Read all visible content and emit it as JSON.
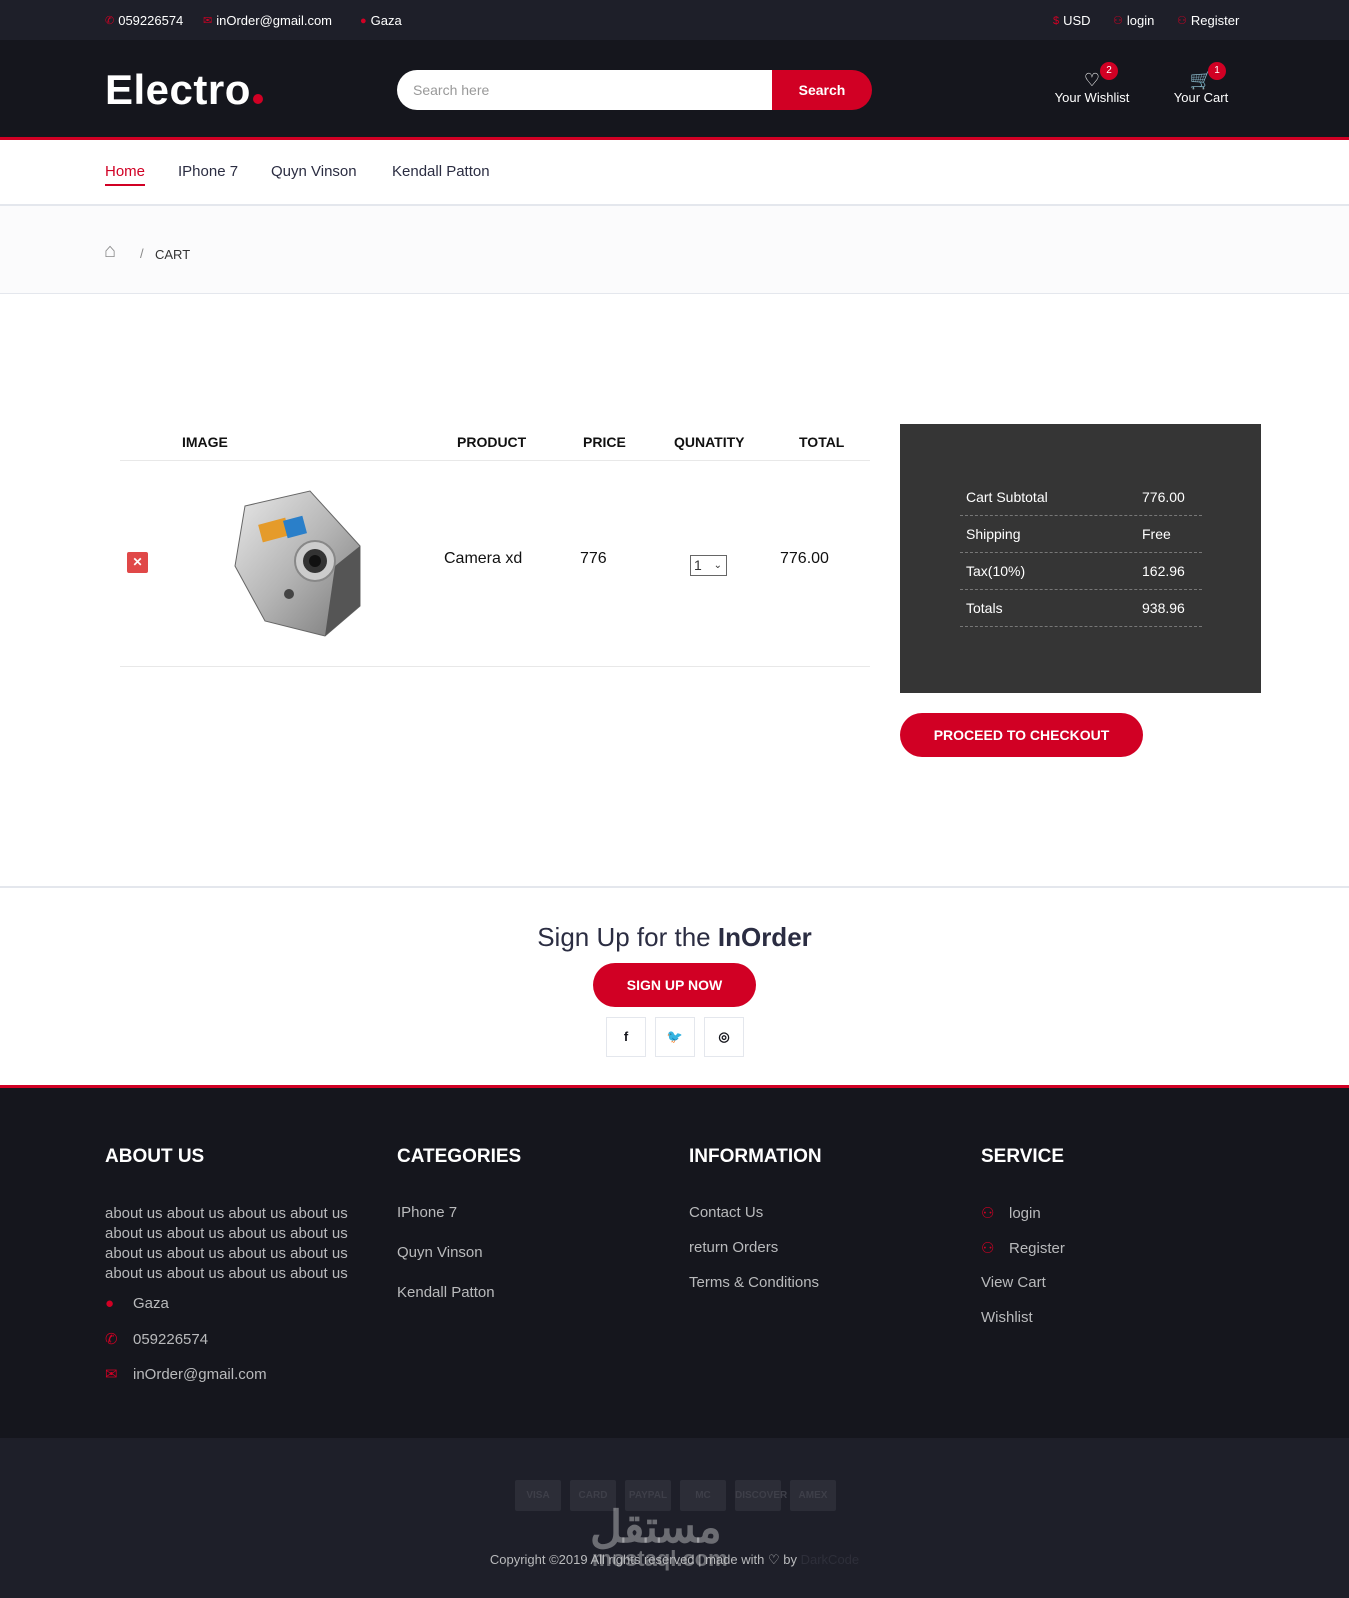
{
  "topbar": {
    "phone": "059226574",
    "email": "inOrder@gmail.com",
    "location": "Gaza",
    "currency": "USD",
    "login": "login",
    "register": "Register"
  },
  "header": {
    "logo": "Electro",
    "search_placeholder": "Search here",
    "search_button": "Search",
    "wishlist_label": "Your Wishlist",
    "wishlist_count": "2",
    "cart_label": "Your Cart",
    "cart_count": "1"
  },
  "nav": {
    "items": [
      "Home",
      "IPhone 7",
      "Quyn Vinson",
      "Kendall Patton"
    ],
    "active": "Home"
  },
  "breadcrumb": {
    "separator": "/",
    "current": "CART"
  },
  "cart": {
    "headers": {
      "image": "IMAGE",
      "product": "PRODUCT",
      "price": "PRICE",
      "quantity": "QUNATITY",
      "total": "TOTAL"
    },
    "items": [
      {
        "product": "Camera xd",
        "price": "776",
        "quantity": "1",
        "total": "776.00"
      }
    ],
    "remove_icon": "times-icon"
  },
  "summary": {
    "rows": [
      {
        "label": "Cart Subtotal",
        "value": "776.00"
      },
      {
        "label": "Shipping",
        "value": "Free"
      },
      {
        "label": "Tax(10%)",
        "value": "162.96"
      },
      {
        "label": "Totals",
        "value": "938.96"
      }
    ],
    "checkout_button": "PROCEED TO CHECKOUT"
  },
  "newsletter": {
    "title_prefix": "Sign Up for the ",
    "title_brand": "InOrder",
    "button": "SIGN UP NOW",
    "social": [
      "f",
      "t",
      "ig"
    ]
  },
  "footer": {
    "about": {
      "title": "ABOUT US",
      "text": "about us about us about us about us about us about us about us about us about us about us about us about us about us about us about us about us",
      "location": "Gaza",
      "phone": "059226574",
      "email": "inOrder@gmail.com"
    },
    "categories": {
      "title": "CATEGORIES",
      "items": [
        "IPhone 7",
        "Quyn Vinson",
        "Kendall Patton"
      ]
    },
    "information": {
      "title": "INFORMATION",
      "items": [
        "Contact Us",
        "return Orders",
        "Terms & Conditions"
      ]
    },
    "service": {
      "title": "SERVICE",
      "items": [
        "login",
        "Register",
        "View Cart",
        "Wishlist"
      ]
    },
    "payment_cards": [
      "VISA",
      "CARD",
      "PAYPAL",
      "MC",
      "DISCOVER",
      "AMEX"
    ],
    "copyright": "Copyright ©2019 All rights reserved | made with ♡ by",
    "author": "DarkCode",
    "watermark": "مستقل",
    "watermark_sub": "mostaql.com"
  },
  "colors": {
    "accent": "#d10024",
    "dark": "#15161d",
    "topbar": "#1e1f29",
    "summary_bg": "#353535"
  }
}
